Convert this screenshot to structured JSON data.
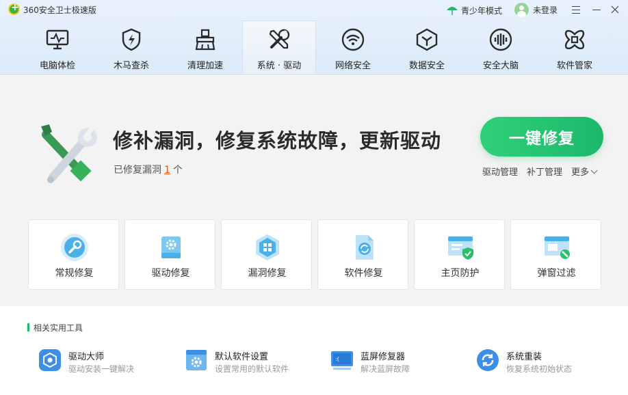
{
  "app": {
    "title": "360安全卫士极速版"
  },
  "titlebar": {
    "youth_mode": "青少年模式",
    "login": "未登录"
  },
  "tabs": [
    {
      "label": "电脑体检",
      "icon": "monitor-icon"
    },
    {
      "label": "木马查杀",
      "icon": "shield-bolt-icon"
    },
    {
      "label": "清理加速",
      "icon": "broom-icon"
    },
    {
      "label": "系统 · 驱动",
      "icon": "wrench-screwdriver-icon",
      "active": true
    },
    {
      "label": "网络安全",
      "icon": "wifi-icon"
    },
    {
      "label": "数据安全",
      "icon": "cube-icon"
    },
    {
      "label": "安全大脑",
      "icon": "brain-icon"
    },
    {
      "label": "软件管家",
      "icon": "app-grid-icon"
    }
  ],
  "hero": {
    "title": "修补漏洞，修复系统故障，更新驱动",
    "sub_prefix": "已修复漏洞",
    "count": "1",
    "sub_suffix": "个",
    "fix_button": "一键修复",
    "links": {
      "driver": "驱动管理",
      "patch": "补丁管理",
      "more": "更多"
    }
  },
  "cards": [
    {
      "label": "常规修复",
      "icon": "wrench-circle-icon"
    },
    {
      "label": "驱动修复",
      "icon": "driver-gear-icon"
    },
    {
      "label": "漏洞修复",
      "icon": "windows-hex-icon"
    },
    {
      "label": "软件修复",
      "icon": "software-refresh-icon"
    },
    {
      "label": "主页防护",
      "icon": "homepage-shield-icon"
    },
    {
      "label": "弹窗过滤",
      "icon": "popup-block-icon"
    }
  ],
  "tools": {
    "heading": "相关实用工具",
    "items": [
      {
        "name": "驱动大师",
        "desc": "驱动安装一键解决",
        "icon": "driver-master-icon"
      },
      {
        "name": "默认软件设置",
        "desc": "设置常用的默认软件",
        "icon": "default-settings-icon"
      },
      {
        "name": "蓝屏修复器",
        "desc": "解决蓝屏故障",
        "icon": "bluescreen-icon"
      },
      {
        "name": "系统重装",
        "desc": "恢复系统初始状态",
        "icon": "reinstall-icon"
      }
    ]
  },
  "colors": {
    "accent_green": "#1bb86a",
    "count_orange": "#e2550a",
    "header_blue": "#dbeaf9"
  }
}
